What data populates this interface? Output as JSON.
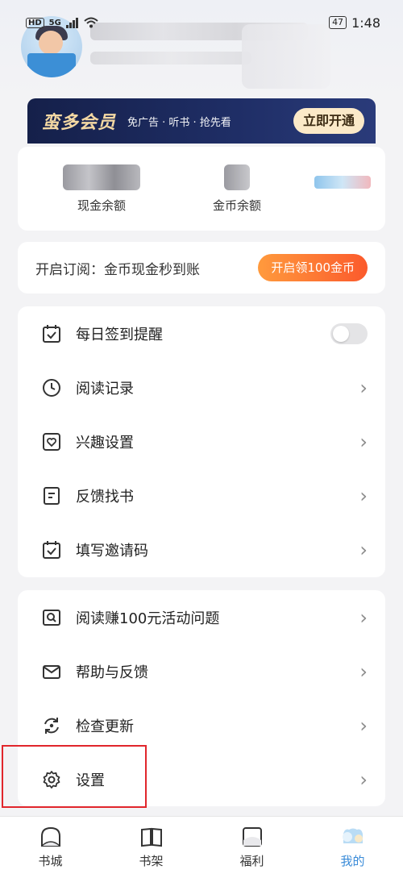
{
  "status_bar": {
    "left_badge": "HD",
    "signal": "5G",
    "battery": "47",
    "time": "1:48"
  },
  "vip": {
    "title": "蛮多会员",
    "subtitle": "免广告 · 听书 · 抢先看",
    "button": "立即开通",
    "colors": {
      "bg": "#15204a",
      "title": "#f3d8a3"
    }
  },
  "balance": {
    "cash_label": "现金余额",
    "coin_label": "金币余额"
  },
  "subscribe": {
    "text": "开启订阅：金币现金秒到账",
    "button": "开启领100金币",
    "button_color": "#fb5a2c"
  },
  "menu_group_1": [
    {
      "label": "每日签到提醒",
      "icon": "calendar-check-icon",
      "control": "toggle",
      "toggle_on": false
    },
    {
      "label": "阅读记录",
      "icon": "clock-icon",
      "control": "chevron"
    },
    {
      "label": "兴趣设置",
      "icon": "heart-icon",
      "control": "chevron"
    },
    {
      "label": "反馈找书",
      "icon": "document-icon",
      "control": "chevron"
    },
    {
      "label": "填写邀请码",
      "icon": "calendar-check-icon",
      "control": "chevron"
    }
  ],
  "menu_group_2": [
    {
      "label": "阅读赚100元活动问题",
      "icon": "search-doc-icon",
      "control": "chevron"
    },
    {
      "label": "帮助与反馈",
      "icon": "mail-icon",
      "control": "chevron"
    },
    {
      "label": "检查更新",
      "icon": "refresh-icon",
      "control": "chevron"
    },
    {
      "label": "设置",
      "icon": "gear-icon",
      "control": "chevron"
    }
  ],
  "tabs": [
    {
      "label": "书城",
      "icon": "store-icon",
      "active": false
    },
    {
      "label": "书架",
      "icon": "bookshelf-icon",
      "active": false
    },
    {
      "label": "福利",
      "icon": "gift-icon",
      "active": false
    },
    {
      "label": "我的",
      "icon": "profile-icon",
      "active": true
    }
  ],
  "highlight_color": "#e1262c"
}
